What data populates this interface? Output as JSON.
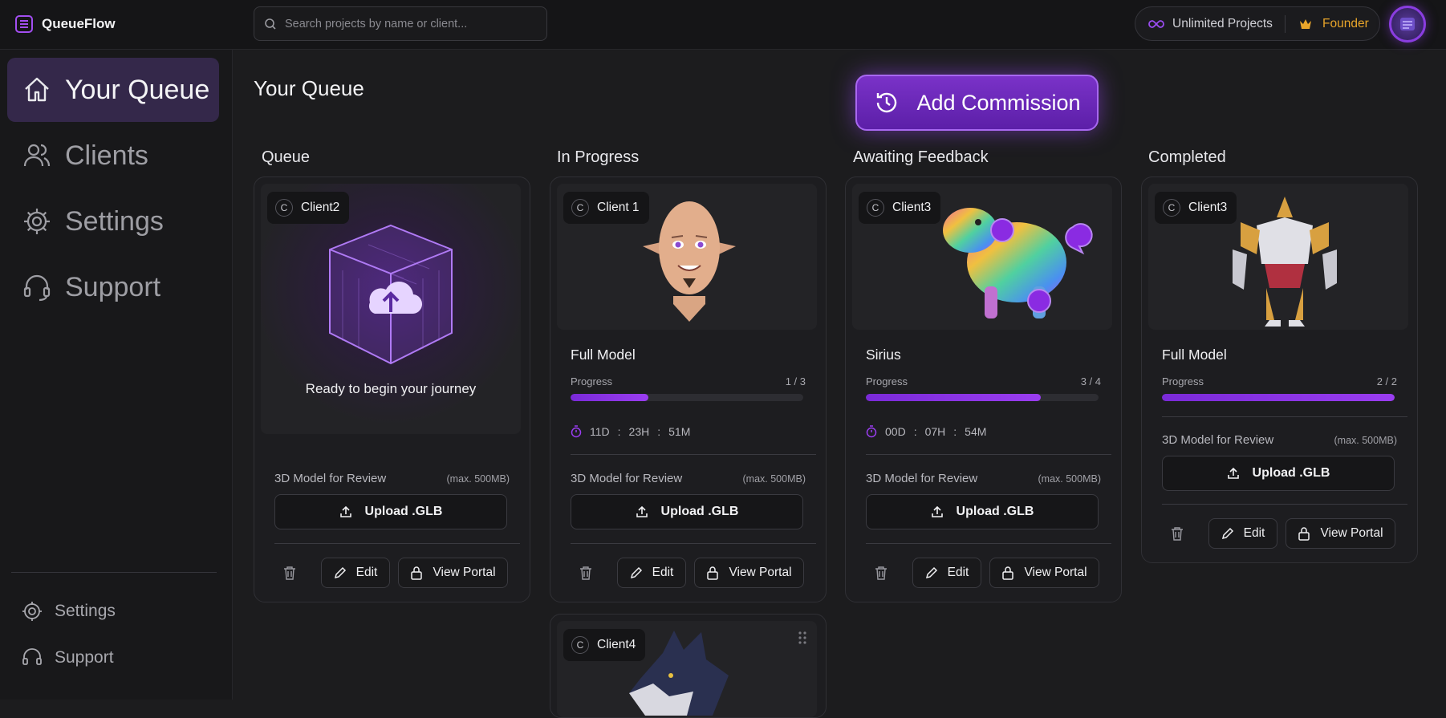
{
  "app": {
    "name": "QueueFlow"
  },
  "search": {
    "placeholder": "Search projects by name or client..."
  },
  "account": {
    "plan_label": "Unlimited Projects",
    "tier_label": "Founder"
  },
  "sidebar": {
    "items": [
      {
        "label": "Your Queue",
        "icon": "home-icon",
        "active": true
      },
      {
        "label": "Clients",
        "icon": "users-icon"
      },
      {
        "label": "Settings",
        "icon": "gear-icon"
      },
      {
        "label": "Support",
        "icon": "headset-icon"
      }
    ],
    "footer": [
      {
        "label": "Settings",
        "icon": "gear-icon"
      },
      {
        "label": "Support",
        "icon": "headset-icon"
      }
    ]
  },
  "main": {
    "title": "Your Queue",
    "add_button": "Add Commission"
  },
  "columns": [
    {
      "title": "Queue"
    },
    {
      "title": "In Progress"
    },
    {
      "title": "Awaiting Feedback"
    },
    {
      "title": "Completed"
    }
  ],
  "cards": {
    "queue": {
      "client": "Client2",
      "avatar_letter": "C",
      "empty_text": "Ready to begin your journey",
      "upload_label": "3D Model for Review",
      "upload_limit": "(max. 500MB)",
      "upload_button": "Upload .GLB",
      "edit": "Edit",
      "portal": "View Portal"
    },
    "progress": {
      "client": "Client 1",
      "avatar_letter": "C",
      "title": "Full Model",
      "progress_label": "Progress",
      "progress_text": "1 / 3",
      "progress_fraction": 0.333,
      "days": "11D",
      "hours": "23H",
      "minutes": "51M",
      "upload_label": "3D Model for Review",
      "upload_limit": "(max. 500MB)",
      "upload_button": "Upload .GLB",
      "edit": "Edit",
      "portal": "View Portal"
    },
    "feedback": {
      "client": "Client3",
      "avatar_letter": "C",
      "title": "Sirius",
      "progress_label": "Progress",
      "progress_text": "3 / 4",
      "progress_fraction": 0.75,
      "days": "00D",
      "hours": "07H",
      "minutes": "54M",
      "upload_label": "3D Model for Review",
      "upload_limit": "(max. 500MB)",
      "upload_button": "Upload .GLB",
      "edit": "Edit",
      "portal": "View Portal"
    },
    "completed": {
      "client": "Client3",
      "avatar_letter": "C",
      "title": "Full Model",
      "progress_label": "Progress",
      "progress_text": "2 / 2",
      "progress_fraction": 1.0,
      "upload_label": "3D Model for Review",
      "upload_limit": "(max. 500MB)",
      "upload_button": "Upload .GLB",
      "edit": "Edit",
      "portal": "View Portal"
    },
    "progress2": {
      "client": "Client4",
      "avatar_letter": "C"
    }
  },
  "colors": {
    "accent": "#8a2be2",
    "background": "#1c1c1e",
    "founder": "#e8a52a"
  }
}
